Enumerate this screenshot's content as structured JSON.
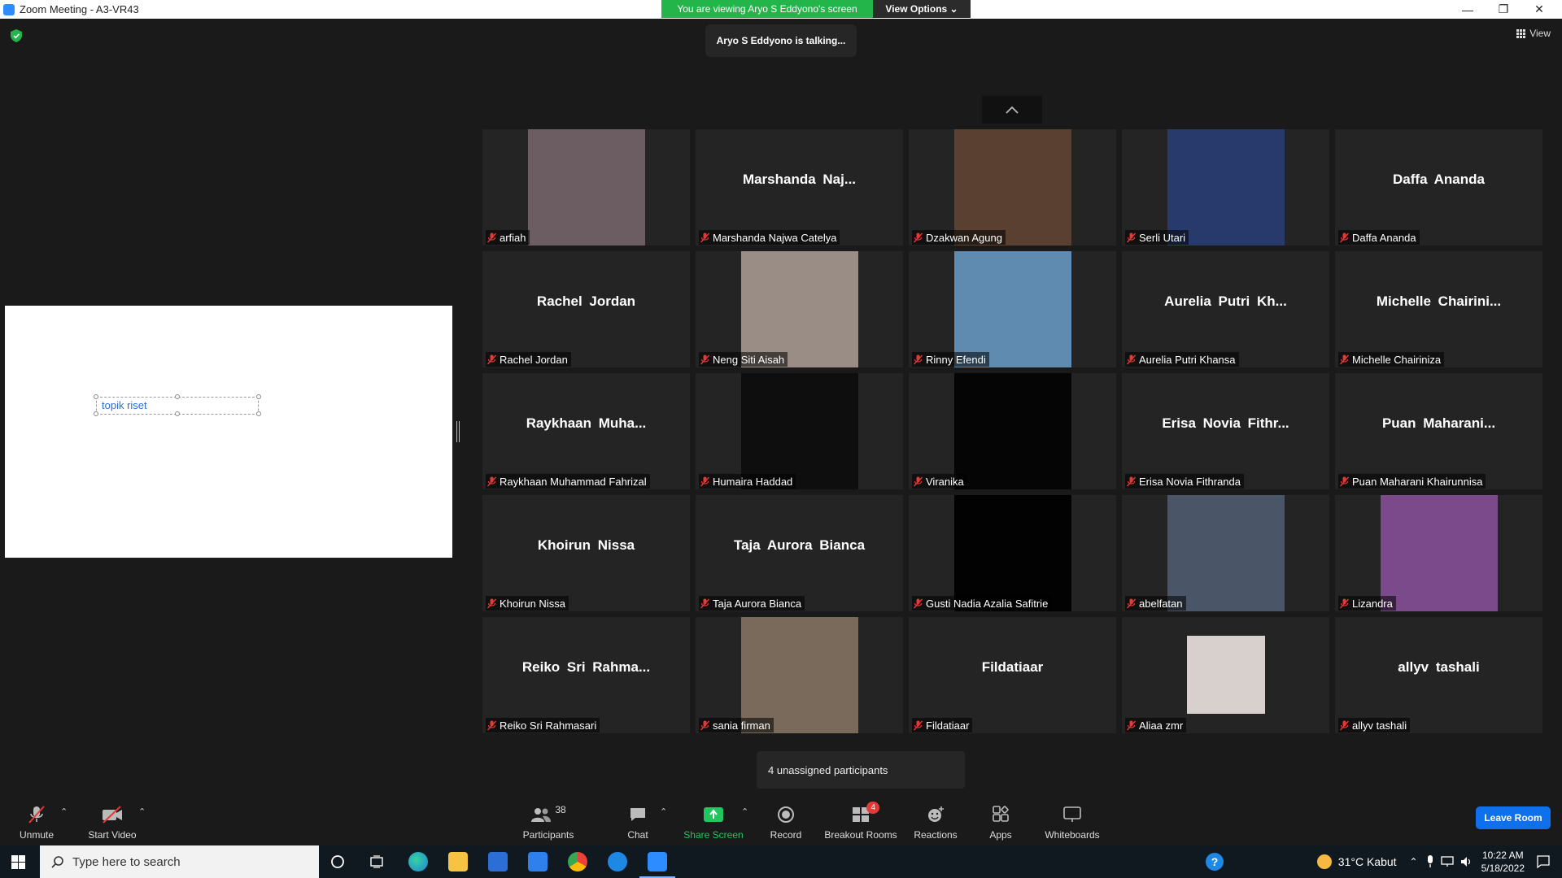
{
  "window": {
    "title": "Zoom Meeting - A3-VR43"
  },
  "banner": {
    "viewing": "You are viewing Aryo S Eddyono's screen",
    "view_options": "View Options ⌄"
  },
  "talking": "Aryo S Eddyono is talking...",
  "view_label": "View",
  "shared_screen": {
    "textbox": "topik riset"
  },
  "participants": [
    {
      "name": "arfiah",
      "big": "",
      "video": true,
      "bg": "#6b5d62"
    },
    {
      "name": "Marshanda Najwa Catelya",
      "big": "Marshanda  Naj...",
      "video": false
    },
    {
      "name": "Dzakwan Agung",
      "big": "",
      "video": true,
      "bg": "#5a4030"
    },
    {
      "name": "Serli Utari",
      "big": "",
      "video": true,
      "bg": "#273a6b"
    },
    {
      "name": "Daffa Ananda",
      "big": "Daffa Ananda",
      "video": false
    },
    {
      "name": "Rachel Jordan",
      "big": "Rachel Jordan",
      "video": false
    },
    {
      "name": "Neng Siti Aisah",
      "big": "",
      "video": true,
      "bg": "#9a8d86"
    },
    {
      "name": "Rinny Efendi",
      "big": "",
      "video": true,
      "bg": "#5f8bb0"
    },
    {
      "name": "Aurelia Putri Khansa",
      "big": "Aurelia Putri Kh...",
      "video": false
    },
    {
      "name": "Michelle Chairiniza",
      "big": "Michelle  Chairini...",
      "video": false
    },
    {
      "name": "Raykhaan Muhammad Fahrizal",
      "big": "Raykhaan  Muha...",
      "video": false
    },
    {
      "name": "Humaira Haddad",
      "big": "",
      "video": true,
      "bg": "#0e0e0e"
    },
    {
      "name": "Viranika",
      "big": "",
      "video": true,
      "bg": "#050505"
    },
    {
      "name": "Erisa Novia Fithranda",
      "big": "Erisa Novia Fithr...",
      "video": false
    },
    {
      "name": "Puan Maharani Khairunnisa",
      "big": "Puan  Maharani...",
      "video": false
    },
    {
      "name": "Khoirun Nissa",
      "big": "Khoirun Nissa",
      "video": false
    },
    {
      "name": "Taja Aurora Bianca",
      "big": "Taja Aurora Bianca",
      "video": false
    },
    {
      "name": "Gusti Nadia Azalia Safitrie",
      "big": "",
      "video": true,
      "bg": "#020202"
    },
    {
      "name": "abelfatan",
      "big": "",
      "video": true,
      "bg": "#4a5568"
    },
    {
      "name": "Lizandra",
      "big": "",
      "video": true,
      "bg": "#7a4a8a"
    },
    {
      "name": "Reiko Sri Rahmasari",
      "big": "Reiko Sri Rahma...",
      "video": false
    },
    {
      "name": "sania firman",
      "big": "",
      "video": true,
      "bg": "#7a6a5c"
    },
    {
      "name": "Fildatiaar",
      "big": "Fildatiaar",
      "video": false
    },
    {
      "name": "Aliaa zmr",
      "big": "",
      "video": true,
      "bg": "#d8d0cc",
      "small": true
    },
    {
      "name": "allyv tashali",
      "big": "allyv tashali",
      "video": false
    }
  ],
  "unassigned": "4 unassigned participants",
  "toolbar": {
    "unmute": "Unmute",
    "start_video": "Start Video",
    "participants": "Participants",
    "participants_count": "38",
    "chat": "Chat",
    "share_screen": "Share Screen",
    "record": "Record",
    "breakout_rooms": "Breakout Rooms",
    "breakout_badge": "4",
    "reactions": "Reactions",
    "apps": "Apps",
    "whiteboards": "Whiteboards",
    "leave": "Leave Room"
  },
  "taskbar": {
    "search_placeholder": "Type here to search",
    "weather": "31°C  Kabut",
    "time": "10:22 AM",
    "date": "5/18/2022"
  },
  "colors": {
    "accent_green": "#23b44a",
    "leave_blue": "#0e71eb",
    "share_green": "#22c55e",
    "muted_red": "#e53935"
  }
}
